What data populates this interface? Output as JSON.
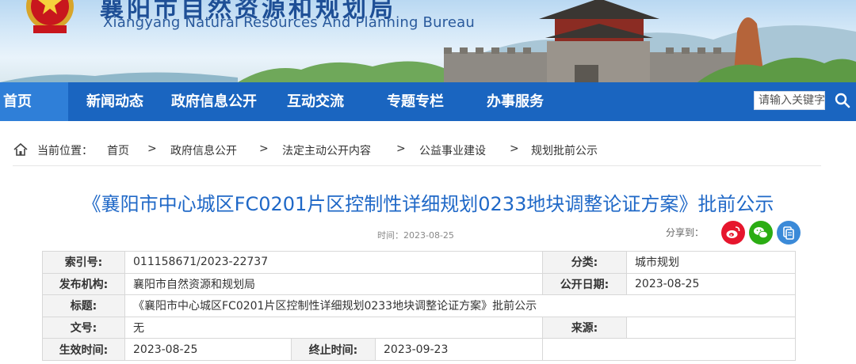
{
  "site": {
    "title_cn": "襄阳市自然资源和规划局",
    "title_en": "Xiangyang Natural Resources And Planning Bureau"
  },
  "nav": {
    "items": [
      {
        "label": "首页",
        "active": true
      },
      {
        "label": "新闻动态"
      },
      {
        "label": "政府信息公开"
      },
      {
        "label": "互动交流"
      },
      {
        "label": "专题专栏"
      },
      {
        "label": "办事服务"
      }
    ],
    "search_placeholder": "请输入关键字",
    "search_icon": "search-icon"
  },
  "breadcrumb": {
    "prefix": "当前位置：",
    "items": [
      "首页",
      "政府信息公开",
      "法定主动公开内容",
      "公益事业建设",
      "规划批前公示"
    ],
    "separator": ">"
  },
  "article": {
    "title": "《襄阳市中心城区FC0201片区控制性详细规划0233地块调整论证方案》批前公示",
    "time_label": "时间：2023-08-25",
    "share_label": "分享到：",
    "share_icons": [
      "weibo-icon",
      "wechat-icon",
      "copy-icon"
    ]
  },
  "info": {
    "index_label": "索引号:",
    "index_value": "011158671/2023-22737",
    "category_label": "分类:",
    "category_value": "城市规划",
    "publisher_label": "发布机构:",
    "publisher_value": "襄阳市自然资源和规划局",
    "pubdate_label": "公开日期:",
    "pubdate_value": "2023-08-25",
    "subject_label": "标题:",
    "subject_value": "《襄阳市中心城区FC0201片区控制性详细规划0233地块调整论证方案》批前公示",
    "docno_label": "文号:",
    "docno_value": "无",
    "source_label": "来源:",
    "source_value": "",
    "effective_label": "生效时间:",
    "effective_value": "2023-08-25",
    "expire_label": "终止时间:",
    "expire_value": "2023-09-23"
  },
  "colors": {
    "nav_bg": "#1a65c0",
    "title_blue": "#1f68c7",
    "weibo": "#e6162d",
    "wechat": "#2bad13",
    "copy": "#3b8ad8"
  }
}
